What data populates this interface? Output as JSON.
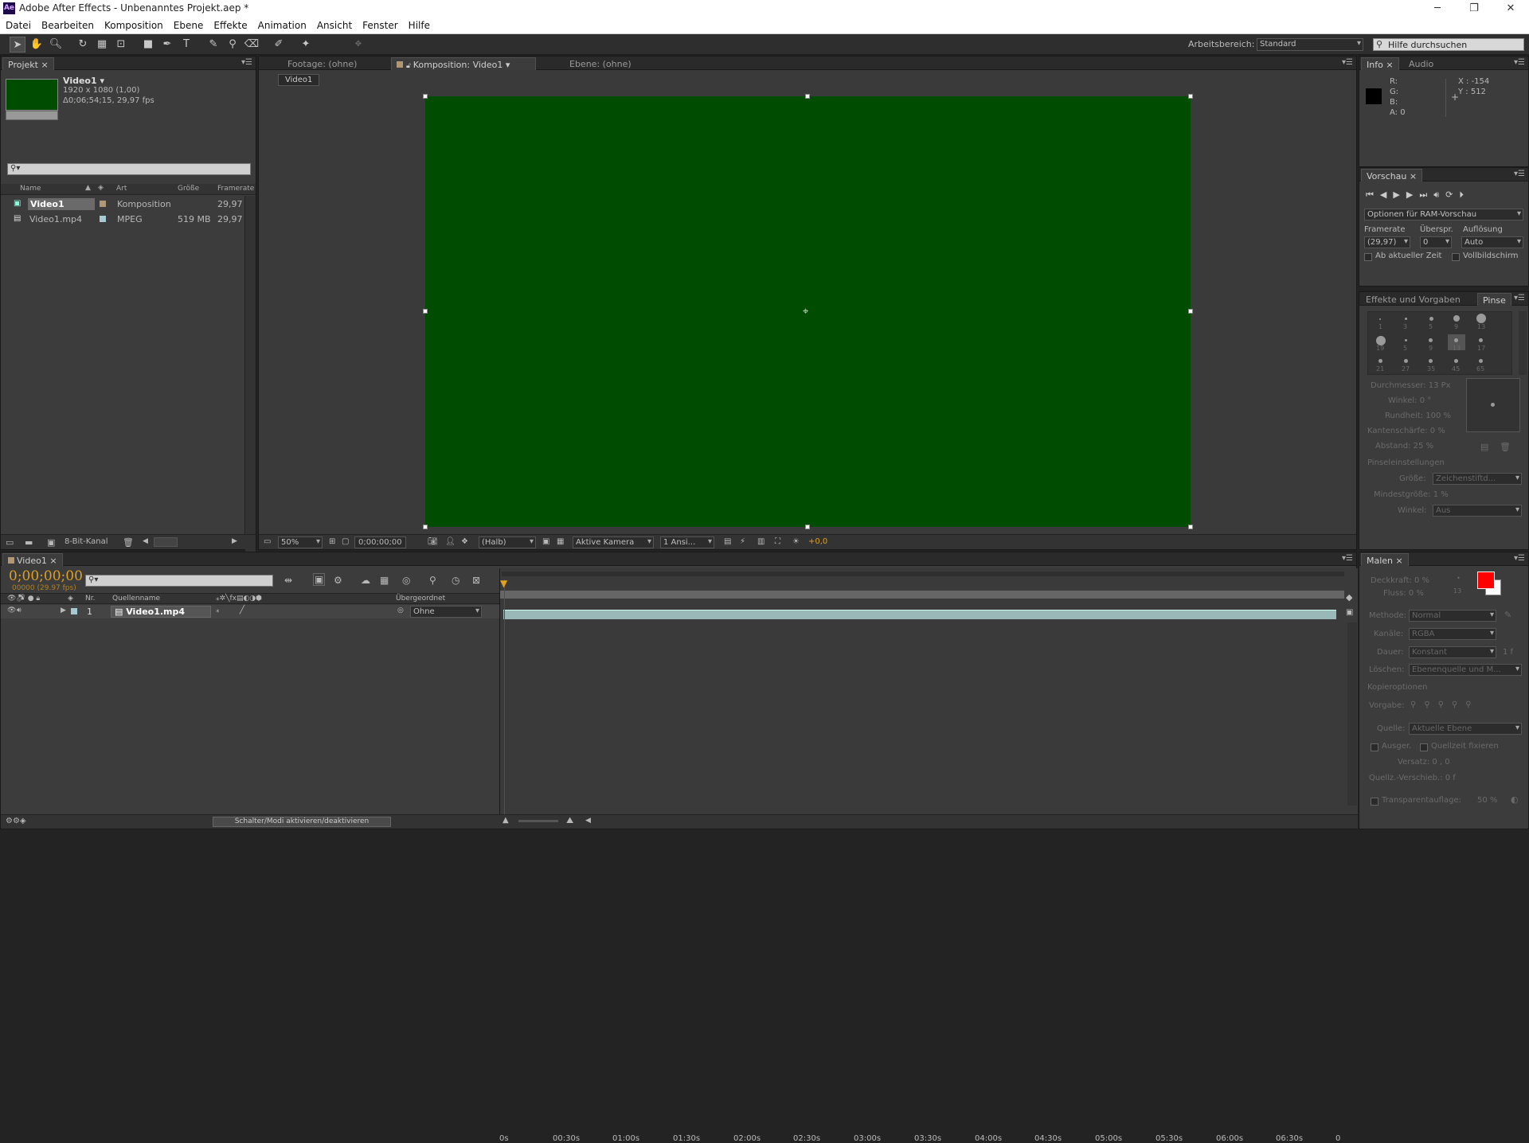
{
  "window": {
    "app_icon": "Ae",
    "title": "Adobe After Effects - Unbenanntes Projekt.aep *",
    "min": "─",
    "max": "❐",
    "close": "✕"
  },
  "menu": [
    "Datei",
    "Bearbeiten",
    "Komposition",
    "Ebene",
    "Effekte",
    "Animation",
    "Ansicht",
    "Fenster",
    "Hilfe"
  ],
  "toolbar": {
    "workspace_label": "Arbeitsbereich:",
    "workspace_value": "Standard",
    "help_placeholder": "Hilfe durchsuchen"
  },
  "project": {
    "tab": "Projekt",
    "comp_name": "Video1 ▾",
    "comp_res": "1920 x 1080 (1,00)",
    "comp_dur": "Δ0;06;54;15, 29,97 fps",
    "columns": {
      "name": "Name",
      "type": "Art",
      "size": "Größe",
      "fps": "Framerate"
    },
    "items": [
      {
        "name": "Video1",
        "type": "Komposition",
        "size": "",
        "fps": "29,97"
      },
      {
        "name": "Video1.mp4",
        "type": "MPEG",
        "size": "519 MB",
        "fps": "29,97"
      }
    ],
    "bitdepth": "8-Bit-Kanal"
  },
  "viewer": {
    "tab_footage": "Footage: (ohne)",
    "tab_comp": "Komposition: Video1",
    "tab_layer": "Ebene: (ohne)",
    "breadcrumb": "Video1",
    "zoom": "50%",
    "timecode": "0;00;00;00",
    "resolution": "(Halb)",
    "camera": "Aktive Kamera",
    "views": "1 Ansi...",
    "exposure": "+0,0",
    "bg_color": "#004c00"
  },
  "info": {
    "tab": "Info",
    "tab2": "Audio",
    "r": "R:",
    "g": "G:",
    "b": "B:",
    "a": "A:  0",
    "x": "X : -154",
    "y": "Y : 512"
  },
  "preview": {
    "tab": "Vorschau",
    "ram_opt": "Optionen für RAM-Vorschau",
    "framerate_label": "Framerate",
    "skip_label": "Überspr.",
    "res_label": "Auflösung",
    "framerate": "(29,97)",
    "skip": "0",
    "res": "Auto",
    "from_current": "Ab aktueller Zeit",
    "fullscreen": "Vollbildschirm"
  },
  "brushes": {
    "tab1": "Effekte und Vorgaben",
    "tab2": "Pinse",
    "sizes": [
      "1",
      "3",
      "5",
      "9",
      "13",
      "19",
      "5",
      "9",
      "13",
      "17",
      "21",
      "27",
      "35",
      "45",
      "65"
    ],
    "diameter": "Durchmesser: 13 Px",
    "angle": "Winkel: 0 °",
    "roundness": "Rundheit: 100 %",
    "hardness": "Kantenschärfe: 0 %",
    "spacing": "Abstand: 25 %",
    "settings": "Pinseleinstellungen",
    "size_label": "Größe:",
    "size_val": "Zeichenstiftd...",
    "minsize": "Mindestgröße: 1 %",
    "angle2_label": "Winkel:",
    "angle2_val": "Aus"
  },
  "timeline": {
    "tab": "Video1",
    "timecode": "0;00;00;00",
    "frames": "00000 (29.97 fps)",
    "cols": {
      "nr": "Nr.",
      "source": "Quellenname",
      "parent": "Übergeordnet"
    },
    "layer": {
      "nr": "1",
      "name": "Video1.mp4",
      "parent": "Ohne"
    },
    "ticks": [
      "0s",
      "00:30s",
      "01:00s",
      "01:30s",
      "02:00s",
      "02:30s",
      "03:00s",
      "03:30s",
      "04:00s",
      "04:30s",
      "05:00s",
      "05:30s",
      "06:00s",
      "06:30s",
      "0"
    ],
    "toggle_btn": "Schalter/Modi aktivieren/deaktivieren"
  },
  "paint": {
    "tab": "Malen",
    "opacity": "Deckkraft: 0 %",
    "flow": "Fluss: 0 %",
    "brush_size": "13",
    "method_label": "Methode:",
    "method": "Normal",
    "channels_label": "Kanäle:",
    "channels": "RGBA",
    "duration_label": "Dauer:",
    "duration": "Konstant",
    "duration_val": "1 f",
    "erase_label": "Löschen:",
    "erase": "Ebenenquelle und M...",
    "clone_opts": "Kopieroptionen",
    "preset_label": "Vorgabe:",
    "source_label": "Quelle:",
    "source": "Aktuelle Ebene",
    "aligned": "Ausger.",
    "lock_src": "Quellzeit fixieren",
    "offset": "Versatz:  0 ,          0",
    "src_shift": "Quellz.-Verschieb.: 0  f",
    "overlay": "Transparentauflage:",
    "overlay_val": "50 %",
    "fg": "#ff0000",
    "bg": "#ffffff"
  }
}
